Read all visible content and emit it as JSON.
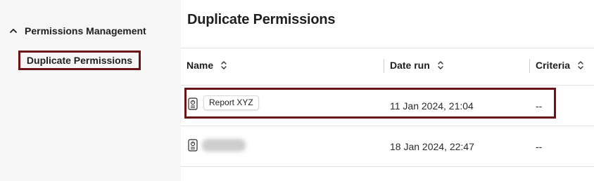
{
  "sidebar": {
    "group_label": "Permissions Management",
    "items": [
      {
        "label": "Duplicate Permissions",
        "selected": true
      }
    ]
  },
  "main": {
    "title": "Duplicate Permissions",
    "columns": [
      {
        "label": "Name",
        "sort_icon": "sort-updown-icon"
      },
      {
        "label": "Date run",
        "sort_icon": "sort-updown-icon"
      },
      {
        "label": "Criteria",
        "sort_icon": "sort-updown-icon"
      }
    ],
    "rows": [
      {
        "icon": "report-document-icon",
        "name": "Report XYZ",
        "date_run": "11 Jan 2024, 21:04",
        "criteria": "--",
        "highlighted": true
      },
      {
        "icon": "report-document-icon",
        "name": "",
        "name_obscured": true,
        "date_run": "18 Jan 2024, 22:47",
        "criteria": "--",
        "highlighted": false
      }
    ]
  },
  "colors": {
    "sidebar_bg": "#f6f6f6",
    "highlight_border": "#6b1416",
    "divider": "#e3e3e3",
    "text": "#1f1f1f"
  }
}
